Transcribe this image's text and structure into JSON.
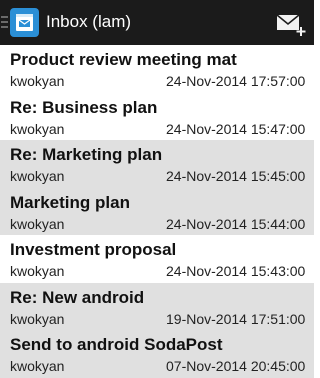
{
  "action_bar": {
    "title": "Inbox (lam)",
    "menu_icon": "hamburger-icon",
    "app_icon": "mail-app-icon",
    "compose_icon": "compose-mail-icon",
    "background_color": "#1b1b1b",
    "accent_color": "#2b8fd6"
  },
  "messages": [
    {
      "subject": "Product review meeting mat",
      "sender": "kwokyan",
      "date": "24-Nov-2014 17:57:00",
      "read": false
    },
    {
      "subject": "Re: Business plan",
      "sender": "kwokyan",
      "date": "24-Nov-2014 15:47:00",
      "read": false
    },
    {
      "subject": "Re: Marketing plan",
      "sender": "kwokyan",
      "date": "24-Nov-2014 15:45:00",
      "read": true
    },
    {
      "subject": "Marketing plan",
      "sender": "kwokyan",
      "date": "24-Nov-2014 15:44:00",
      "read": true
    },
    {
      "subject": "Investment proposal",
      "sender": "kwokyan",
      "date": "24-Nov-2014 15:43:00",
      "read": false
    },
    {
      "subject": "Re: New android",
      "sender": "kwokyan",
      "date": "19-Nov-2014 17:51:00",
      "read": true
    },
    {
      "subject": "Send to android SodaPost",
      "sender": "kwokyan",
      "date": "07-Nov-2014 20:45:00",
      "read": true
    }
  ]
}
